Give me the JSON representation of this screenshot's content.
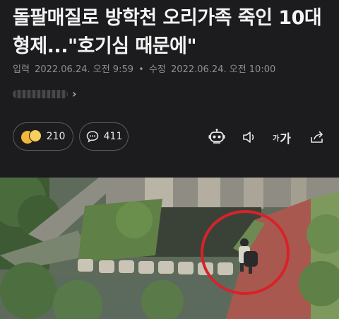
{
  "article": {
    "headline": "돌팔매질로 방학천 오리가족 죽인 10대 형제...\"호기심 때문에\"",
    "meta": {
      "input_label": "입력",
      "input_time": "2022.06.24. 오전 9:59",
      "separator": "•",
      "edit_label": "수정",
      "edit_time": "2022.06.24. 오전 10:00"
    },
    "reporter": {
      "chevron": "›"
    }
  },
  "actions": {
    "reaction_count": "210",
    "comment_count": "411",
    "font_small": "가",
    "font_large": "가"
  },
  "colors": {
    "background": "#1c1c1e",
    "headline": "#f4f4f4",
    "meta": "#8e8e93",
    "highlight_circle": "#d8222a"
  },
  "icons": [
    "smile-emoji-icon",
    "comment-icon",
    "robot-summary-icon",
    "speaker-icon",
    "font-size-icon",
    "share-icon"
  ]
}
